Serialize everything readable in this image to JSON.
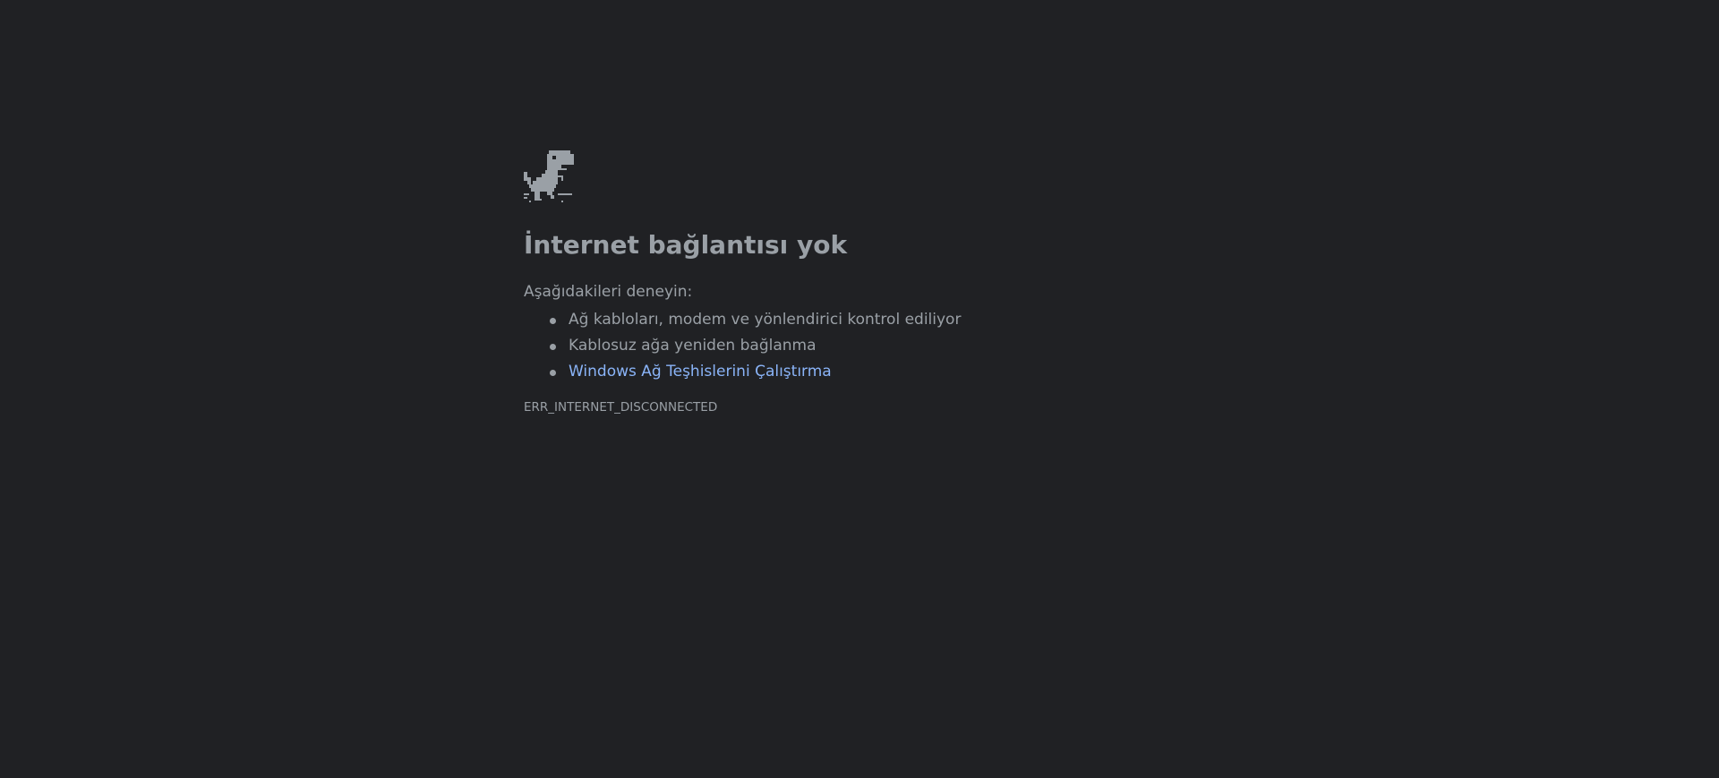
{
  "page": {
    "background": "#202124",
    "text_color": "#9aa0a6",
    "link_color": "#8ab4f8"
  },
  "icon": "dinosaur-icon",
  "heading": "İnternet bağlantısı yok",
  "suggestions_intro": "Aşağıdakileri deneyin:",
  "suggestions": [
    {
      "label": "Ağ kabloları, modem ve yönlendirici kontrol ediliyor",
      "is_link": false
    },
    {
      "label": "Kablosuz ağa yeniden bağlanma",
      "is_link": false
    },
    {
      "label": "Windows Ağ Teşhislerini Çalıştırma",
      "is_link": true
    }
  ],
  "error_code": "ERR_INTERNET_DISCONNECTED"
}
